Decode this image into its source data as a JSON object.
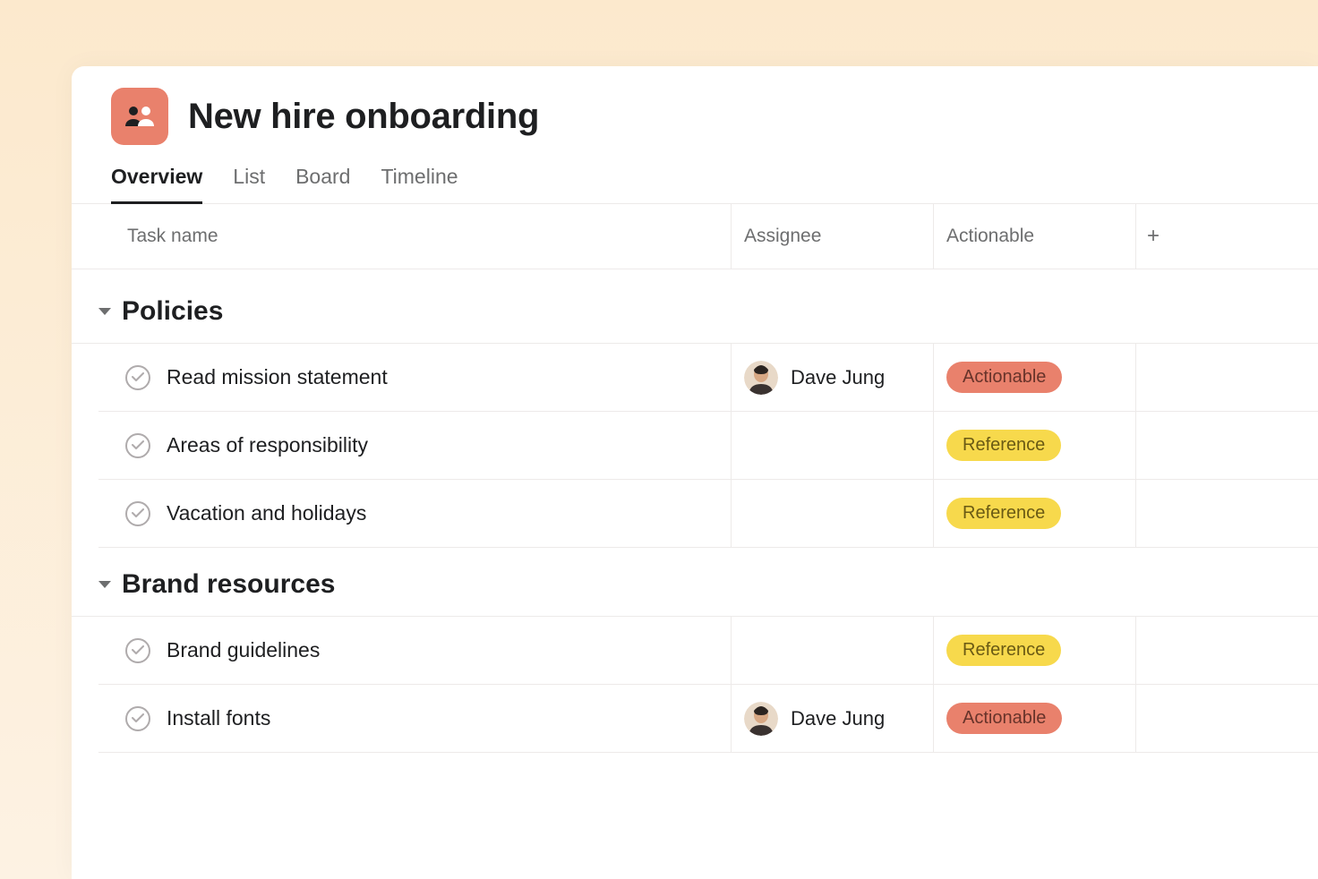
{
  "project": {
    "title": "New hire onboarding"
  },
  "tabs": {
    "overview": "Overview",
    "list": "List",
    "board": "Board",
    "timeline": "Timeline"
  },
  "columns": {
    "task": "Task name",
    "assignee": "Assignee",
    "actionable": "Actionable"
  },
  "sections": [
    {
      "title": "Policies",
      "tasks": [
        {
          "name": "Read mission statement",
          "assignee": "Dave Jung",
          "tag": "Actionable"
        },
        {
          "name": "Areas of responsibility",
          "assignee": "",
          "tag": "Reference"
        },
        {
          "name": "Vacation and holidays",
          "assignee": "",
          "tag": "Reference"
        }
      ]
    },
    {
      "title": "Brand resources",
      "tasks": [
        {
          "name": "Brand guidelines",
          "assignee": "",
          "tag": "Reference"
        },
        {
          "name": "Install fonts",
          "assignee": "Dave Jung",
          "tag": "Actionable"
        }
      ]
    }
  ],
  "tagStyles": {
    "Actionable": "pill-actionable",
    "Reference": "pill-reference"
  }
}
